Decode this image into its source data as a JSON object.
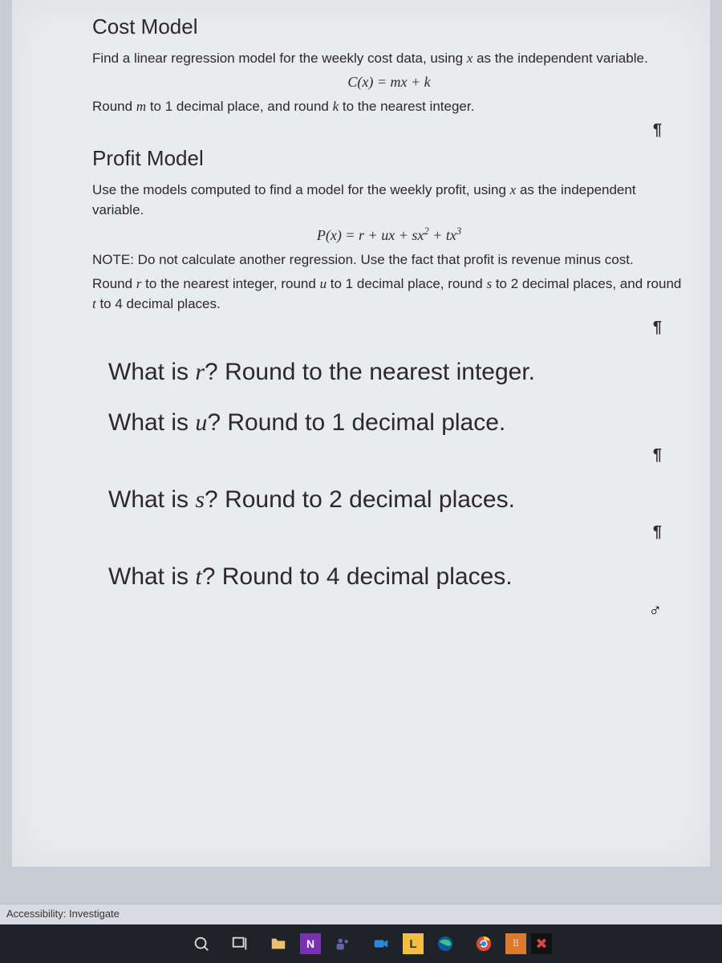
{
  "costModel": {
    "heading": "Cost Model",
    "instruction_pre": "Find a linear regression model for the weekly cost data, using ",
    "instruction_var": "x",
    "instruction_post": " as the independent variable.",
    "equation": "C(x) = mx + k",
    "rounding_pre": "Round ",
    "rounding_m": "m",
    "rounding_mid": " to 1 decimal place, and round ",
    "rounding_k": "k",
    "rounding_post": " to the nearest integer."
  },
  "profitModel": {
    "heading": "Profit Model",
    "instruction_pre": "Use the models computed to find a model for the weekly profit, using ",
    "instruction_var": "x",
    "instruction_post": " as the independent variable.",
    "equation_html": "P(x) = r + ux + sx² + tx³",
    "note": "NOTE: Do not calculate another regression.  Use the fact that profit is revenue minus cost.",
    "rounding": "Round r to the nearest integer, round u to 1 decimal place, round s to 2 decimal places, and round t to 4 decimal places."
  },
  "questions": {
    "q_r_pre": "What is ",
    "q_r_var": "r",
    "q_r_post": "?  Round to the nearest integer.",
    "q_u_pre": "What is ",
    "q_u_var": "u",
    "q_u_post": "?  Round to 1 decimal place.",
    "q_s_pre": "What is ",
    "q_s_var": "s",
    "q_s_post": "?  Round to 2 decimal places.",
    "q_t_pre": "What is ",
    "q_t_var": "t",
    "q_t_post": "?  Round to 4 decimal places."
  },
  "marks": {
    "pilcrow": "¶",
    "cursor": "♂"
  },
  "statusBar": {
    "accessibility": "Accessibility: Investigate"
  },
  "taskbar": {
    "search": "O",
    "taskview": "⊞",
    "explorer": "📁",
    "n": "N",
    "teams": "T",
    "camera": "◉",
    "l": "L",
    "edge": "e",
    "chrome": "◎",
    "app1": "▦",
    "app2": "✕"
  }
}
